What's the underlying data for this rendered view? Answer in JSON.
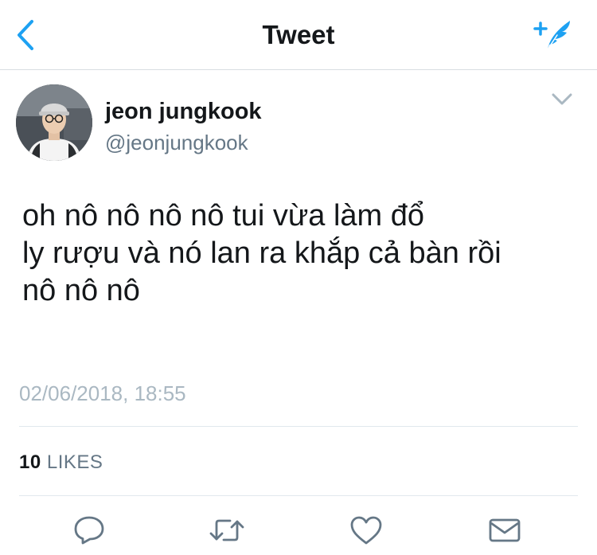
{
  "header": {
    "title": "Tweet",
    "back_icon": "chevron-left-icon",
    "compose_icon": "compose-tweet-icon",
    "accent_color": "#1da1f2"
  },
  "author": {
    "name": "jeon jungkook",
    "handle": "@jeonjungkook",
    "avatar": "profile-photo"
  },
  "tweet": {
    "text": "oh nô nô nô nô tui vừa làm đổ\nly rượu và nó lan ra khắp cả bàn rồi\nnô nô nô",
    "timestamp": "02/06/2018, 18:55"
  },
  "stats": {
    "likes_count": "10",
    "likes_label": "LIKES"
  },
  "actions": [
    {
      "name": "reply",
      "icon": "reply-icon"
    },
    {
      "name": "retweet",
      "icon": "retweet-icon"
    },
    {
      "name": "like",
      "icon": "heart-icon"
    },
    {
      "name": "direct-message",
      "icon": "envelope-icon"
    }
  ]
}
